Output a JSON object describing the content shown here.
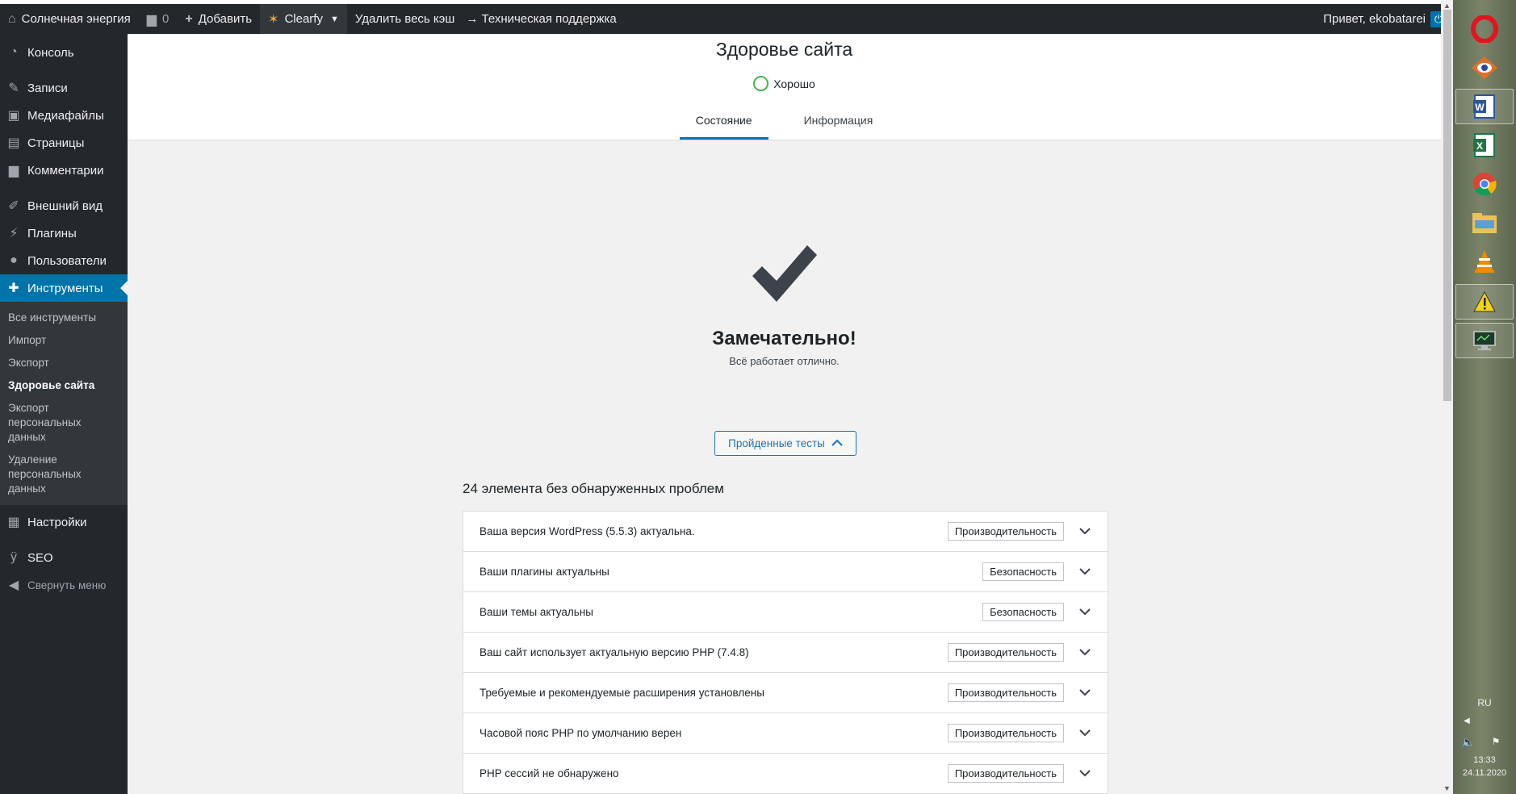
{
  "adminbar": {
    "site_name": "Солнечная энергия",
    "comments_count": "0",
    "add_label": "Добавить",
    "clearfy_label": "Clearfy",
    "purge_cache_label": "Удалить весь кэш",
    "support_label": "→ Техническая поддержка",
    "greeting": "Привет, ekobatarei"
  },
  "sidebar": {
    "items": [
      {
        "label": "Консоль",
        "icon": "dashboard-icon"
      },
      {
        "label": "Записи",
        "icon": "pin-icon"
      },
      {
        "label": "Медиафайлы",
        "icon": "media-icon"
      },
      {
        "label": "Страницы",
        "icon": "page-icon"
      },
      {
        "label": "Комментарии",
        "icon": "comment-icon"
      },
      {
        "label": "Внешний вид",
        "icon": "brush-icon"
      },
      {
        "label": "Плагины",
        "icon": "plug-icon"
      },
      {
        "label": "Пользователи",
        "icon": "user-icon"
      },
      {
        "label": "Инструменты",
        "icon": "wrench-icon"
      },
      {
        "label": "Настройки",
        "icon": "settings-icon"
      },
      {
        "label": "SEO",
        "icon": "yoast-icon"
      },
      {
        "label": "Свернуть меню",
        "icon": "collapse-icon"
      }
    ],
    "submenu": [
      "Все инструменты",
      "Импорт",
      "Экспорт",
      "Здоровье сайта",
      "Экспорт персональных данных",
      "Удаление персональных данных"
    ]
  },
  "header": {
    "title": "Здоровье сайта",
    "status": "Хорошо",
    "tabs": [
      "Состояние",
      "Информация"
    ]
  },
  "main": {
    "headline": "Замечательно!",
    "subheadline": "Всё работает отлично.",
    "passed_button": "Пройденные тесты",
    "section_title": "24 элемента без обнаруженных проблем",
    "tests": [
      {
        "label": "Ваша версия WordPress (5.5.3) актуальна.",
        "badge": "Производительность"
      },
      {
        "label": "Ваши плагины актуальны",
        "badge": "Безопасность"
      },
      {
        "label": "Ваши темы актуальны",
        "badge": "Безопасность"
      },
      {
        "label": "Ваш сайт использует актуальную версию PHP (7.4.8)",
        "badge": "Производительность"
      },
      {
        "label": "Требуемые и рекомендуемые расширения установлены",
        "badge": "Производительность"
      },
      {
        "label": "Часовой пояс PHP по умолчанию верен",
        "badge": "Производительность"
      },
      {
        "label": "PHP сессий не обнаружено",
        "badge": "Производительность"
      }
    ]
  },
  "taskbar": {
    "lang": "RU",
    "time": "13:33",
    "date": "24.11.2020"
  },
  "colors": {
    "accent": "#0073aa",
    "adminbar": "#23282d",
    "good": "#46b450"
  }
}
